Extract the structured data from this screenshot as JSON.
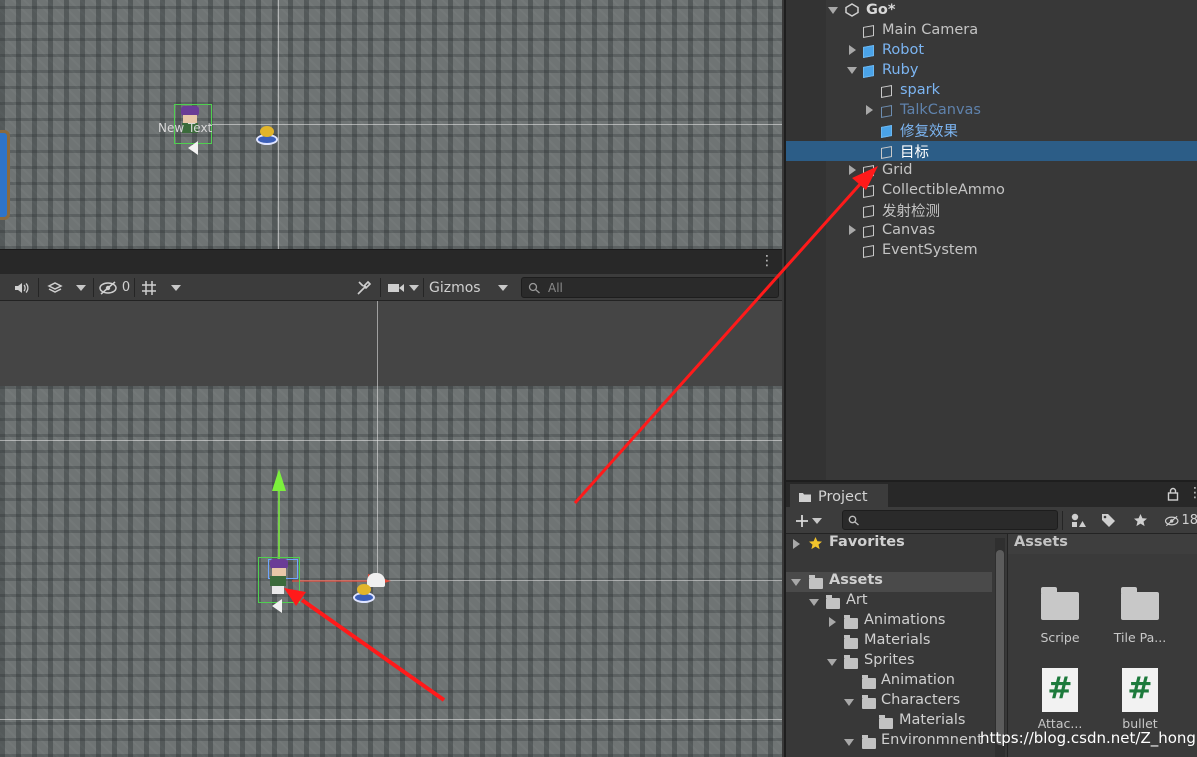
{
  "game_view": {
    "overlay_text": "New Text"
  },
  "scene_toolbar": {
    "hidden_count": "0",
    "gizmos_label": "Gizmos",
    "search_placeholder": "All"
  },
  "hierarchy": {
    "scene_name": "Go*",
    "items": [
      {
        "label": "Main Camera",
        "type": "object",
        "color": "normal"
      },
      {
        "label": "Robot",
        "type": "prefab",
        "color": "blue"
      },
      {
        "label": "Ruby",
        "type": "prefab",
        "color": "blue"
      },
      {
        "label": "spark",
        "type": "object",
        "color": "blue"
      },
      {
        "label": "TalkCanvas",
        "type": "object",
        "color": "dim-blue"
      },
      {
        "label": "修复效果",
        "type": "prefab",
        "color": "blue"
      },
      {
        "label": "目标",
        "type": "object",
        "color": "normal",
        "selected": true
      },
      {
        "label": "Grid",
        "type": "object",
        "color": "normal"
      },
      {
        "label": "CollectibleAmmo",
        "type": "object",
        "color": "normal"
      },
      {
        "label": "发射检测",
        "type": "object",
        "color": "normal"
      },
      {
        "label": "Canvas",
        "type": "object",
        "color": "normal"
      },
      {
        "label": "EventSystem",
        "type": "object",
        "color": "normal"
      }
    ]
  },
  "project": {
    "tab_label": "Project",
    "hidden_count": "18",
    "tree": [
      {
        "label": "Favorites",
        "bold": true
      },
      {
        "label": "Assets",
        "bold": true
      },
      {
        "label": "Art"
      },
      {
        "label": "Animations"
      },
      {
        "label": "Materials"
      },
      {
        "label": "Sprites"
      },
      {
        "label": "Animation"
      },
      {
        "label": "Characters"
      },
      {
        "label": "Materials"
      },
      {
        "label": "Environmnent"
      }
    ],
    "assets_header": "Assets",
    "assets": [
      {
        "label": "Scripe",
        "kind": "folder-icon"
      },
      {
        "label": "Tile Pa...",
        "kind": "folder-icon"
      },
      {
        "label": "Attac...",
        "kind": "csharp-script-icon"
      },
      {
        "label": "bullet",
        "kind": "csharp-script-icon"
      }
    ],
    "script_glyph": "#"
  },
  "watermark": "https://blog.csdn.net/Z_hongli",
  "colors": {
    "selection": "#2c5d87",
    "prefab_blue": "#7cb5f2",
    "annotation_red": "#ff1a1a",
    "gizmo_green": "#7cf03c"
  }
}
